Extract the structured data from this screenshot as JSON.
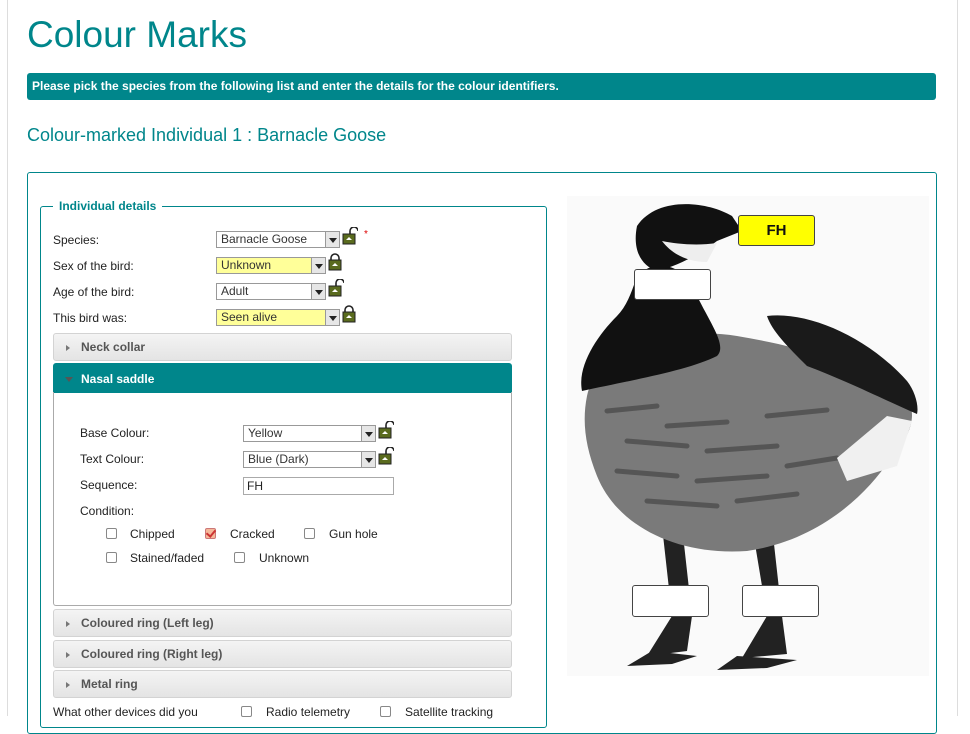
{
  "page_title": "Colour Marks",
  "info_message": "Please pick the species from the following list and enter the details for the colour identifiers.",
  "subtitle": "Colour-marked Individual 1 : Barnacle Goose",
  "individual_details": {
    "legend": "Individual details",
    "species": {
      "label": "Species:",
      "value": "Barnacle Goose",
      "required": "*"
    },
    "sex": {
      "label": "Sex of the bird:",
      "value": "Unknown"
    },
    "age": {
      "label": "Age of the bird:",
      "value": "Adult"
    },
    "status": {
      "label": "This bird was:",
      "value": "Seen alive"
    }
  },
  "accordion": {
    "neck_collar": "Neck collar",
    "nasal_saddle": "Nasal saddle",
    "ring_left": "Coloured ring (Left leg)",
    "ring_right": "Coloured ring (Right leg)",
    "metal_ring": "Metal ring"
  },
  "nasal_saddle": {
    "base_colour": {
      "label": "Base Colour:",
      "value": "Yellow"
    },
    "text_colour": {
      "label": "Text Colour:",
      "value": "Blue (Dark)"
    },
    "sequence": {
      "label": "Sequence:",
      "value": "FH"
    },
    "condition": {
      "label": "Condition:",
      "options": [
        {
          "label": "Chipped",
          "checked": false
        },
        {
          "label": "Cracked",
          "checked": true
        },
        {
          "label": "Gun hole",
          "checked": false
        },
        {
          "label": "Stained/faded",
          "checked": false
        },
        {
          "label": "Unknown",
          "checked": false
        }
      ]
    }
  },
  "devices": {
    "label": "What other devices did you",
    "options": [
      "Radio telemetry",
      "Satellite tracking"
    ]
  },
  "bird_preview": {
    "saddle_text": "FH"
  },
  "colors": {
    "accent": "#00868b",
    "highlight": "#ffff99",
    "saddle": "#ffff00"
  },
  "icons": [
    "lock-icon",
    "unlock-icon",
    "dropdown-arrow-icon",
    "triangle-right-icon",
    "triangle-down-icon"
  ]
}
